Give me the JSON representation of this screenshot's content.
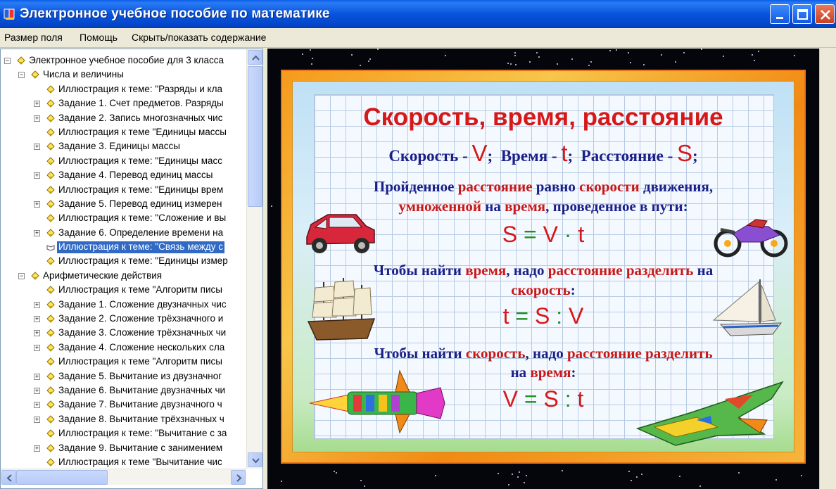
{
  "window": {
    "title": "Электронное учебное пособие по математике",
    "icon": "book-app-icon",
    "controls": {
      "minimize": "minimize-icon",
      "maximize": "maximize-icon",
      "close": "close-icon"
    }
  },
  "menu": {
    "items": [
      {
        "label": "Размер поля"
      },
      {
        "label": "Помощь"
      },
      {
        "label": "Скрыть/показать содержание"
      }
    ]
  },
  "tree": {
    "items": [
      {
        "label": "Электронное учебное пособие для 3 класса",
        "level": 0,
        "expander": "minus"
      },
      {
        "label": "Числа и величины",
        "level": 1,
        "expander": "minus"
      },
      {
        "label": "Иллюстрация к теме: \"Разряды и кла",
        "level": 2,
        "expander": "none"
      },
      {
        "label": "Задание 1. Счет предметов. Разряды",
        "level": 2,
        "expander": "plus"
      },
      {
        "label": "Задание 2. Запись многозначных чис",
        "level": 2,
        "expander": "plus"
      },
      {
        "label": "Иллюстрация к теме \"Единицы массы",
        "level": 2,
        "expander": "none"
      },
      {
        "label": "Задание 3. Единицы массы",
        "level": 2,
        "expander": "plus"
      },
      {
        "label": "Иллюстрация к теме: \"Единицы масс",
        "level": 2,
        "expander": "none"
      },
      {
        "label": "Задание 4. Перевод единиц массы",
        "level": 2,
        "expander": "plus"
      },
      {
        "label": "Иллюстрация к теме: \"Единицы врем",
        "level": 2,
        "expander": "none"
      },
      {
        "label": "Задание 5. Перевод единиц измерен",
        "level": 2,
        "expander": "plus"
      },
      {
        "label": "Иллюстрация к теме: \"Сложение и вы",
        "level": 2,
        "expander": "none"
      },
      {
        "label": "Задание 6. Определение времени на",
        "level": 2,
        "expander": "plus"
      },
      {
        "label": "Иллюстрация к теме: \"Связь между с",
        "level": 2,
        "expander": "none",
        "selected": true
      },
      {
        "label": "Иллюстрация к теме: \"Единицы измер",
        "level": 2,
        "expander": "none"
      },
      {
        "label": "Арифметические действия",
        "level": 1,
        "expander": "minus"
      },
      {
        "label": "Иллюстрация к теме \"Алгоритм писы",
        "level": 2,
        "expander": "none"
      },
      {
        "label": "Задание 1. Сложение двузначных чис",
        "level": 2,
        "expander": "plus"
      },
      {
        "label": "Задание 2. Сложение трёхзначного и",
        "level": 2,
        "expander": "plus"
      },
      {
        "label": "Задание 3. Сложение трёхзначных чи",
        "level": 2,
        "expander": "plus"
      },
      {
        "label": "Задание 4. Сложение нескольких сла",
        "level": 2,
        "expander": "plus"
      },
      {
        "label": "Иллюстрация к теме \"Алгоритм писы",
        "level": 2,
        "expander": "none"
      },
      {
        "label": "Задание 5. Вычитание из двузначног",
        "level": 2,
        "expander": "plus"
      },
      {
        "label": "Задание 6. Вычитание двузначных чи",
        "level": 2,
        "expander": "plus"
      },
      {
        "label": "Задание 7. Вычитание двузначного ч",
        "level": 2,
        "expander": "plus"
      },
      {
        "label": "Задание 8. Вычитание трёхзначных ч",
        "level": 2,
        "expander": "plus"
      },
      {
        "label": "Иллюстрация к теме: \"Вычитание с за",
        "level": 2,
        "expander": "none"
      },
      {
        "label": "Задание 9. Вычитание с занимением",
        "level": 2,
        "expander": "plus"
      },
      {
        "label": "Иллюстрация к теме \"Вычитание чис",
        "level": 2,
        "expander": "none"
      }
    ]
  },
  "slide": {
    "title": "Скорость, время, расстояние",
    "definitions": {
      "speed_label": "Скорость - ",
      "speed_symbol": "V",
      "sep1": ";",
      "time_label": "Время - ",
      "time_symbol": "t",
      "sep2": ";",
      "distance_label": "Расстояние - ",
      "distance_symbol": "S",
      "sep3": ";"
    },
    "rule1": {
      "line1_a": "Пройденное ",
      "line1_b": "расстояние",
      "line1_c": " равно ",
      "line1_d": "скорости",
      "line1_e": " движения,",
      "line2_a": "умноженной",
      "line2_b": " на ",
      "line2_c": "время",
      "line2_d": ", проведенное в пути:"
    },
    "formula1": {
      "a": "S",
      "op1": " = ",
      "b": "V",
      "op2": " · ",
      "c": "t"
    },
    "rule2": {
      "line1_a": "Чтобы найти ",
      "line1_b": "время",
      "line1_c": ", надо ",
      "line1_d": "расстояние разделить",
      "line1_e": " на",
      "line2_a": "скорость",
      "line2_b": ":"
    },
    "formula2": {
      "a": "t",
      "op1": " = ",
      "b": "S",
      "op2": " : ",
      "c": "V"
    },
    "rule3": {
      "line1_a": "Чтобы найти ",
      "line1_b": "скорость",
      "line1_c": ", надо ",
      "line1_d": "расстояние разделить",
      "line2_a": "на ",
      "line2_b": "время",
      "line2_c": ":"
    },
    "formula3": {
      "a": "V",
      "op1": " = ",
      "b": "S",
      "op2": " : ",
      "c": "t"
    },
    "pictures": [
      "car-illustration",
      "motorcycle-illustration",
      "sailing-ship-illustration",
      "sailboat-illustration",
      "rocket-illustration",
      "spaceship-illustration"
    ]
  }
}
